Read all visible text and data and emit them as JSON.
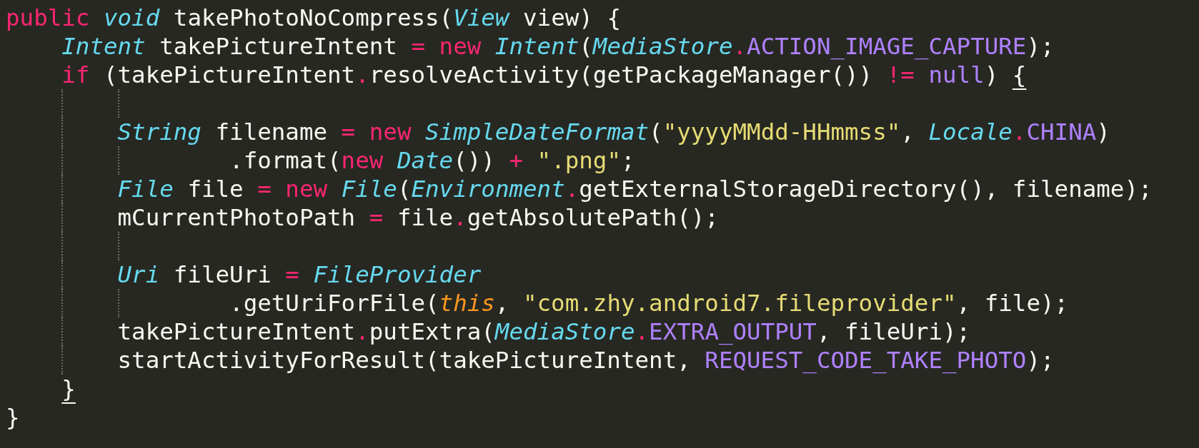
{
  "editor": {
    "lines": [
      {
        "kind": "code",
        "tokens": [
          {
            "t": "public ",
            "kind": "kw"
          },
          {
            "t": "void",
            "kind": "type"
          },
          {
            "t": " takePhotoNoCompress(",
            "kind": "plain"
          },
          {
            "t": "View",
            "kind": "type"
          },
          {
            "t": " view) {",
            "kind": "plain"
          }
        ],
        "children": [
          {
            "kind": "code",
            "tokens": [
              {
                "t": "Intent",
                "kind": "type"
              },
              {
                "t": " takePictureIntent ",
                "kind": "plain"
              },
              {
                "t": "= new ",
                "kind": "kw"
              },
              {
                "t": "Intent",
                "kind": "type"
              },
              {
                "t": "(",
                "kind": "plain"
              },
              {
                "t": "MediaStore",
                "kind": "type"
              },
              {
                "t": ".",
                "kind": "kw"
              },
              {
                "t": "ACTION_IMAGE_CAPTURE",
                "kind": "const"
              },
              {
                "t": ");",
                "kind": "plain"
              }
            ]
          },
          {
            "kind": "code",
            "tokens": [
              {
                "t": "if",
                "kind": "kw"
              },
              {
                "t": " (takePictureIntent",
                "kind": "plain"
              },
              {
                "t": ".",
                "kind": "kw"
              },
              {
                "t": "resolveActivity(getPackageManager()) ",
                "kind": "plain"
              },
              {
                "t": "!= ",
                "kind": "kw"
              },
              {
                "t": "null",
                "kind": "const"
              },
              {
                "t": ") ",
                "kind": "plain"
              },
              {
                "t": "{",
                "kind": "plain",
                "underlined": true
              }
            ],
            "children": [
              {
                "kind": "blank"
              },
              {
                "kind": "code",
                "tokens": [
                  {
                    "t": "String",
                    "kind": "type"
                  },
                  {
                    "t": " filename ",
                    "kind": "plain"
                  },
                  {
                    "t": "= new ",
                    "kind": "kw"
                  },
                  {
                    "t": "SimpleDateFormat",
                    "kind": "type"
                  },
                  {
                    "t": "(",
                    "kind": "plain"
                  },
                  {
                    "t": "\"yyyyMMdd-HHmmss\"",
                    "kind": "str"
                  },
                  {
                    "t": ", ",
                    "kind": "plain"
                  },
                  {
                    "t": "Locale",
                    "kind": "type"
                  },
                  {
                    "t": ".",
                    "kind": "kw"
                  },
                  {
                    "t": "CHINA",
                    "kind": "const"
                  },
                  {
                    "t": ")",
                    "kind": "plain"
                  }
                ],
                "children": [
                  {
                    "kind": "continuation",
                    "tokens": [
                      {
                        "t": ".format(",
                        "kind": "plain"
                      },
                      {
                        "t": "new ",
                        "kind": "kw"
                      },
                      {
                        "t": "Date",
                        "kind": "type"
                      },
                      {
                        "t": "()) ",
                        "kind": "plain"
                      },
                      {
                        "t": "+ ",
                        "kind": "kw"
                      },
                      {
                        "t": "\".png\"",
                        "kind": "str"
                      },
                      {
                        "t": ";",
                        "kind": "plain"
                      }
                    ]
                  }
                ]
              },
              {
                "kind": "code",
                "tokens": [
                  {
                    "t": "File",
                    "kind": "type"
                  },
                  {
                    "t": " file ",
                    "kind": "plain"
                  },
                  {
                    "t": "= new ",
                    "kind": "kw"
                  },
                  {
                    "t": "File",
                    "kind": "type"
                  },
                  {
                    "t": "(",
                    "kind": "plain"
                  },
                  {
                    "t": "Environment",
                    "kind": "type"
                  },
                  {
                    "t": ".",
                    "kind": "kw"
                  },
                  {
                    "t": "getExternalStorageDirectory(), filename);",
                    "kind": "plain"
                  }
                ]
              },
              {
                "kind": "code",
                "tokens": [
                  {
                    "t": "mCurrentPhotoPath ",
                    "kind": "plain"
                  },
                  {
                    "t": "=",
                    "kind": "kw"
                  },
                  {
                    "t": " file",
                    "kind": "plain"
                  },
                  {
                    "t": ".",
                    "kind": "kw"
                  },
                  {
                    "t": "getAbsolutePath();",
                    "kind": "plain"
                  }
                ]
              },
              {
                "kind": "blank"
              },
              {
                "kind": "code",
                "tokens": [
                  {
                    "t": "Uri",
                    "kind": "type"
                  },
                  {
                    "t": " fileUri ",
                    "kind": "plain"
                  },
                  {
                    "t": "= ",
                    "kind": "kw"
                  },
                  {
                    "t": "FileProvider",
                    "kind": "type"
                  }
                ],
                "children": [
                  {
                    "kind": "continuation",
                    "tokens": [
                      {
                        "t": ".getUriForFile(",
                        "kind": "plain"
                      },
                      {
                        "t": "this",
                        "kind": "self"
                      },
                      {
                        "t": ", ",
                        "kind": "plain"
                      },
                      {
                        "t": "\"com.zhy.android7.fileprovider\"",
                        "kind": "str"
                      },
                      {
                        "t": ", file);",
                        "kind": "plain"
                      }
                    ]
                  }
                ]
              },
              {
                "kind": "code",
                "tokens": [
                  {
                    "t": "takePictureIntent",
                    "kind": "plain"
                  },
                  {
                    "t": ".",
                    "kind": "kw"
                  },
                  {
                    "t": "putExtra(",
                    "kind": "plain"
                  },
                  {
                    "t": "MediaStore",
                    "kind": "type"
                  },
                  {
                    "t": ".",
                    "kind": "kw"
                  },
                  {
                    "t": "EXTRA_OUTPUT",
                    "kind": "const"
                  },
                  {
                    "t": ", fileUri);",
                    "kind": "plain"
                  }
                ]
              },
              {
                "kind": "code",
                "tokens": [
                  {
                    "t": "startActivityForResult(takePictureIntent, ",
                    "kind": "plain"
                  },
                  {
                    "t": "REQUEST_CODE_TAKE_PHOTO",
                    "kind": "const"
                  },
                  {
                    "t": ");",
                    "kind": "plain"
                  }
                ]
              }
            ]
          },
          {
            "kind": "code",
            "tokens": [
              {
                "t": "}",
                "kind": "plain",
                "underlined": true
              }
            ]
          }
        ]
      },
      {
        "kind": "code",
        "tokens": [
          {
            "t": "}",
            "kind": "plain"
          }
        ]
      }
    ]
  }
}
